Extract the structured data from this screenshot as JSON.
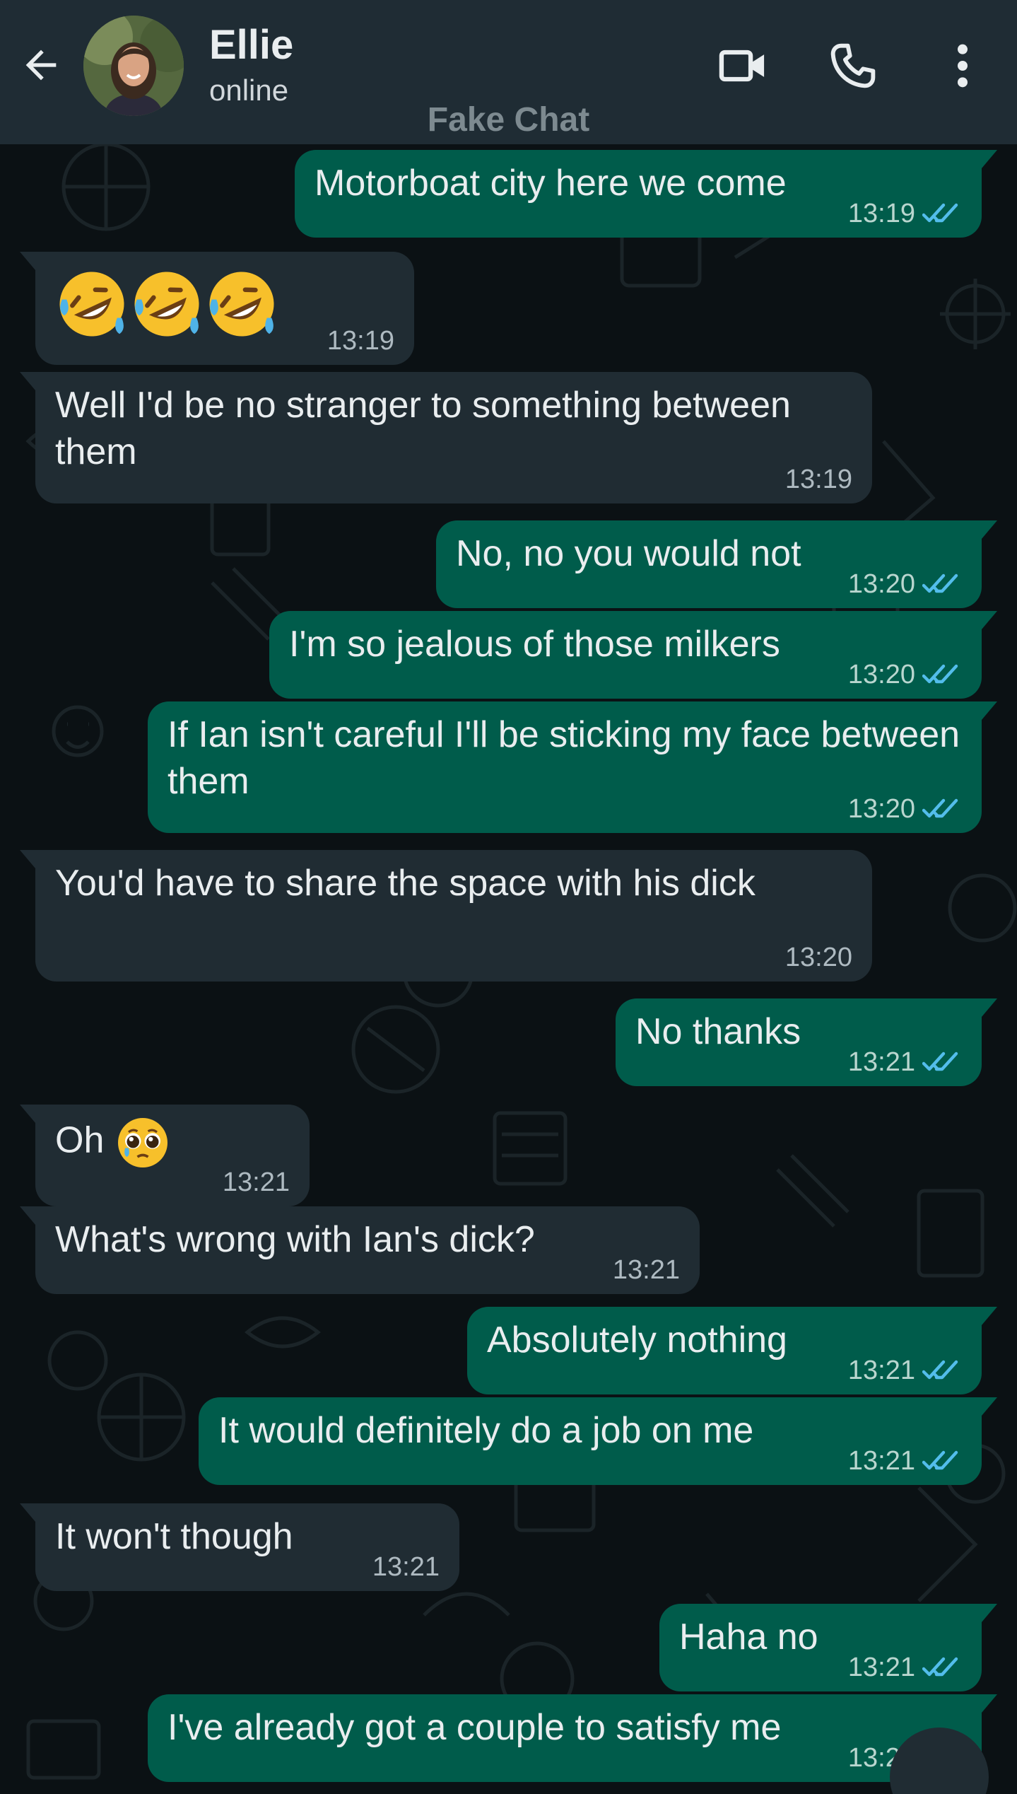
{
  "header": {
    "contact_name": "Ellie",
    "status": "online",
    "watermark": "Fake Chat",
    "icons": [
      "back-arrow-icon",
      "video-call-icon",
      "voice-call-icon",
      "more-options-icon"
    ]
  },
  "colors": {
    "header_bg": "#1f2c34",
    "chat_bg": "#0b1114",
    "incoming_bubble": "#202c33",
    "outgoing_bubble": "#005c4b",
    "read_tick": "#53bdeb"
  },
  "messages": [
    {
      "direction": "out",
      "text": "Motorboat city here we come",
      "time": "13:19",
      "status": "read"
    },
    {
      "direction": "in",
      "text": "",
      "emoji": [
        "rolling-on-floor-laughing",
        "rolling-on-floor-laughing",
        "rolling-on-floor-laughing"
      ],
      "time": "13:19"
    },
    {
      "direction": "in",
      "text": "Well I'd be no stranger to something between them",
      "time": "13:19"
    },
    {
      "direction": "out",
      "text": "No, no you would not",
      "time": "13:20",
      "status": "read"
    },
    {
      "direction": "out",
      "text": "I'm so jealous of those milkers",
      "time": "13:20",
      "status": "read"
    },
    {
      "direction": "out",
      "text": "If Ian isn't careful I'll be sticking my face between them",
      "time": "13:20",
      "status": "read"
    },
    {
      "direction": "in",
      "text": "You'd have to share the space with his dick",
      "time": "13:20"
    },
    {
      "direction": "out",
      "text": "No thanks",
      "time": "13:21",
      "status": "read"
    },
    {
      "direction": "in",
      "text": "Oh",
      "emoji": [
        "pleading-face"
      ],
      "time": "13:21"
    },
    {
      "direction": "in",
      "text": "What's wrong with Ian's dick?",
      "time": "13:21"
    },
    {
      "direction": "out",
      "text": "Absolutely nothing",
      "time": "13:21",
      "status": "read"
    },
    {
      "direction": "out",
      "text": "It would definitely do a job on me",
      "time": "13:21",
      "status": "read"
    },
    {
      "direction": "in",
      "text": "It won't though",
      "time": "13:21"
    },
    {
      "direction": "out",
      "text": "Haha no",
      "time": "13:21",
      "status": "read"
    },
    {
      "direction": "out",
      "text": "I've already got a couple to satisfy me",
      "time": "13:21",
      "status": "read"
    }
  ]
}
